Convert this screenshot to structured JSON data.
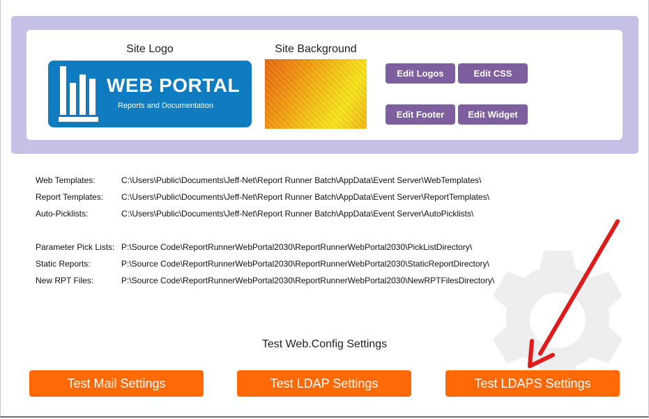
{
  "branding": {
    "logo_label": "Site Logo",
    "background_label": "Site Background",
    "logo_title": "WEB PORTAL",
    "logo_subtitle": "Reports and Documentation"
  },
  "edit_buttons": {
    "logos": "Edit Logos",
    "css": "Edit CSS",
    "footer": "Edit Footer",
    "widget": "Edit Widget"
  },
  "paths": [
    {
      "label": "Web Templates:",
      "value": "C:\\Users\\Public\\Documents\\Jeff-Net\\Report Runner Batch\\AppData\\Event Server\\WebTemplates\\"
    },
    {
      "label": "Report Templates:",
      "value": "C:\\Users\\Public\\Documents\\Jeff-Net\\Report Runner Batch\\AppData\\Event Server\\ReportTemplates\\"
    },
    {
      "label": "Auto-Picklists:",
      "value": "C:\\Users\\Public\\Documents\\Jeff-Net\\Report Runner Batch\\AppData\\Event Server\\AutoPicklists\\"
    },
    {
      "label": "Parameter Pick Lists:",
      "value": "P:\\Source Code\\ReportRunnerWebPortal2030\\ReportRunnerWebPortal2030\\PickListDirectory\\"
    },
    {
      "label": "Static Reports:",
      "value": "P:\\Source Code\\ReportRunnerWebPortal2030\\ReportRunnerWebPortal2030\\StaticReportDirectory\\"
    },
    {
      "label": "New RPT Files:",
      "value": "P:\\Source Code\\ReportRunnerWebPortal2030\\ReportRunnerWebPortal2030\\NewRPTFilesDirectory\\"
    }
  ],
  "test_section": {
    "title": "Test Web.Config Settings",
    "mail": "Test Mail Settings",
    "ldap": "Test LDAP Settings",
    "ldaps": "Test LDAPS Settings"
  },
  "colors": {
    "banner": "#c5c0e5",
    "edit_button": "#7d5e9e",
    "test_button": "#ff6a06",
    "logo_bg": "#0f7cc2",
    "arrow": "#e01b1b"
  }
}
